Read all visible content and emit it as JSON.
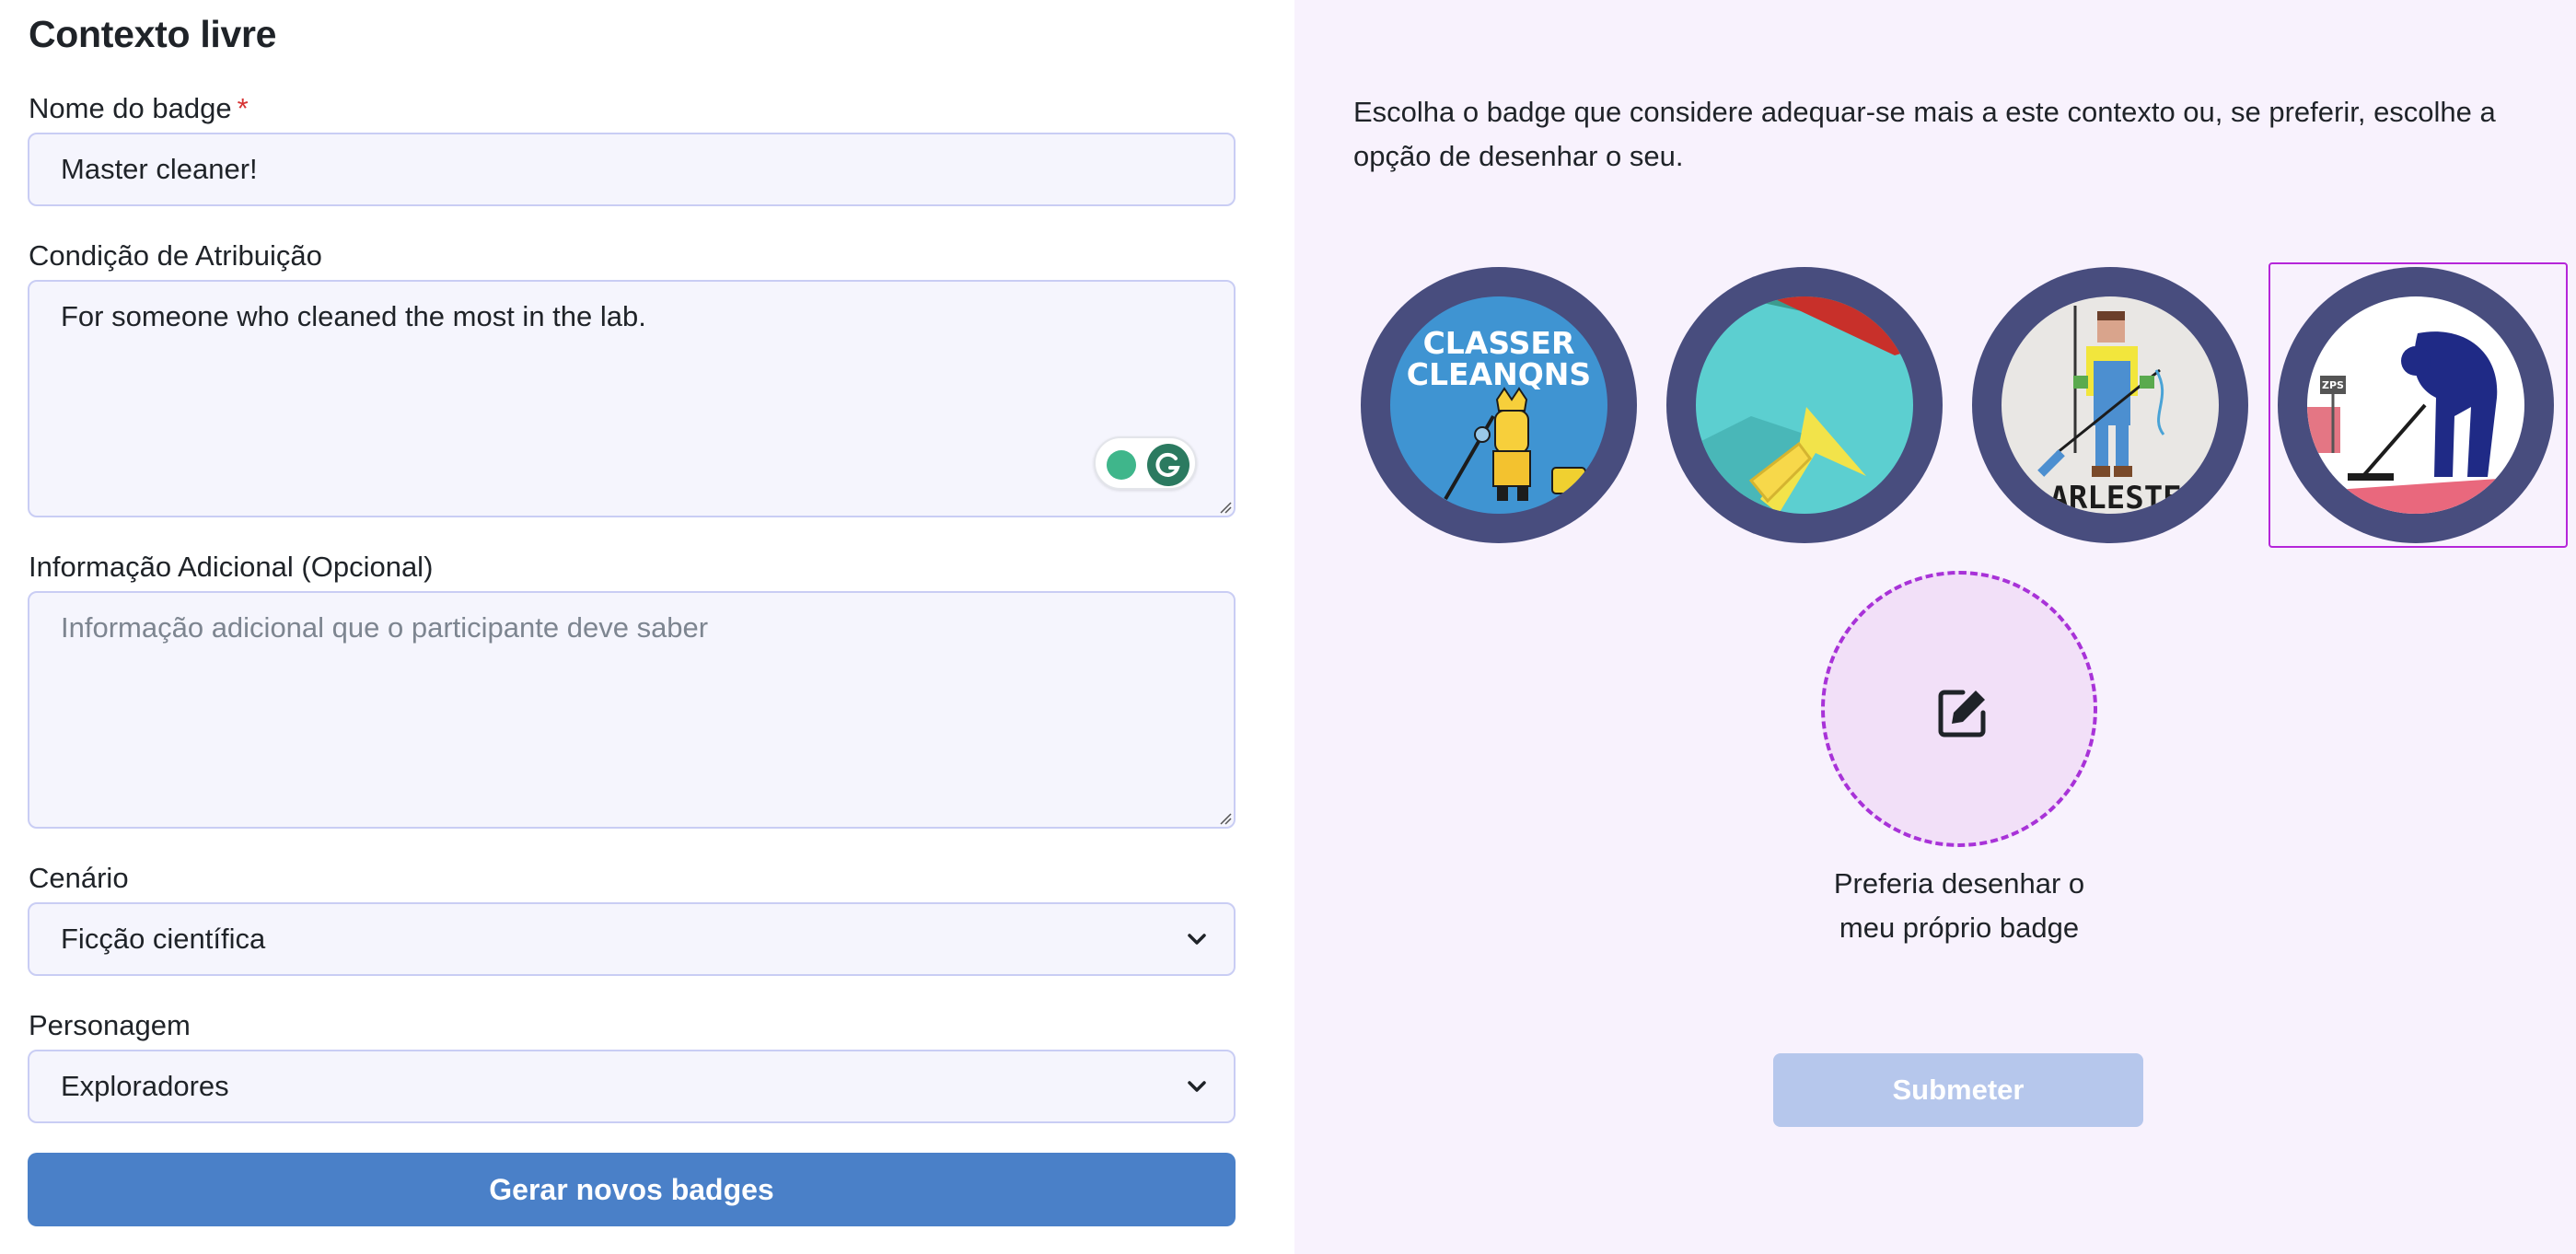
{
  "form": {
    "title": "Contexto livre",
    "badge_name": {
      "label": "Nome do badge",
      "required_mark": "*",
      "value": "Master cleaner!"
    },
    "condition": {
      "label": "Condição de Atribuição",
      "value": "For someone who cleaned the most in the lab."
    },
    "additional_info": {
      "label": "Informação Adicional (Opcional)",
      "placeholder": "Informação adicional que o participante deve saber"
    },
    "scenario": {
      "label": "Cenário",
      "selected": "Ficção científica"
    },
    "character": {
      "label": "Personagem",
      "selected": "Exploradores"
    },
    "generate_button": "Gerar novos badges"
  },
  "chooser": {
    "intro": "Escolha o badge que considere adequar-se mais a este contexto ou, se preferir, escolhe a opção de desenhar o seu.",
    "badges": [
      {
        "name": "badge-option-1",
        "text": "CLASSER CLEANQNS",
        "selected": false
      },
      {
        "name": "badge-option-2",
        "selected": false
      },
      {
        "name": "badge-option-3",
        "text": "ARLESTE",
        "selected": false
      },
      {
        "name": "badge-option-4",
        "text": "ZPS",
        "selected": true
      }
    ],
    "draw_option_label": "Preferia desenhar o meu próprio badge",
    "draw_icon": "edit-icon",
    "submit_button": "Submeter"
  },
  "colors": {
    "primary_button": "#4a80c8",
    "disabled_button": "#b6c7ec",
    "badge_ring": "#484d7e",
    "selection_outline": "#b526d9",
    "right_panel_bg": "#f8f2fd",
    "required": "#d63232"
  }
}
